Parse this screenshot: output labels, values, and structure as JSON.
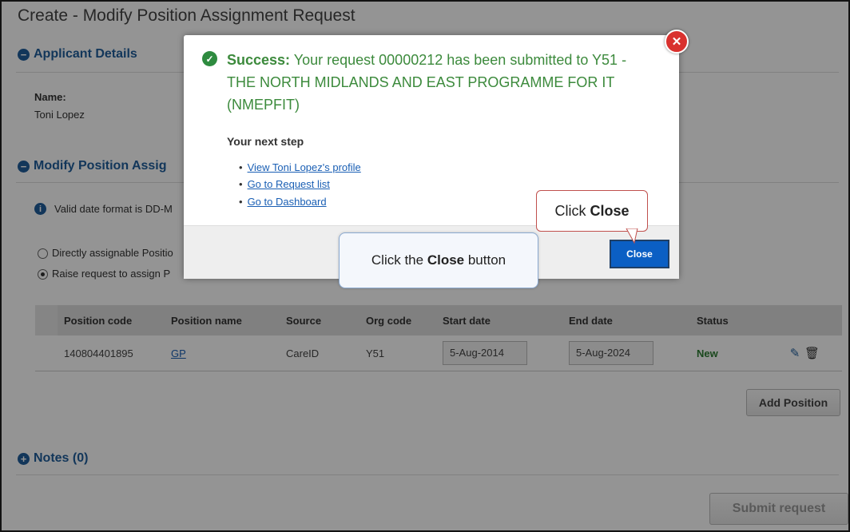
{
  "page": {
    "title": "Create - Modify Position Assignment Request"
  },
  "applicant": {
    "heading": "Applicant Details",
    "name_label": "Name:",
    "name_value": "Toni Lopez"
  },
  "modify": {
    "heading": "Modify Position Assig",
    "info_text": "Valid date format is DD-M",
    "radio_1": "Directly assignable Positio",
    "radio_2": "Raise request to assign P",
    "selected_radio": 2
  },
  "table": {
    "headers": [
      "Position code",
      "Position name",
      "Source",
      "Org code",
      "Start date",
      "End date",
      "Status"
    ],
    "rows": [
      {
        "position_code": "140804401895",
        "position_name": "GP",
        "source": "CareID",
        "org_code": "Y51",
        "start_date": "5-Aug-2014",
        "end_date": "5-Aug-2024",
        "status": "New"
      }
    ]
  },
  "buttons": {
    "add_position": "Add Position",
    "submit_request": "Submit request"
  },
  "notes": {
    "heading": "Notes (0)"
  },
  "modal": {
    "success_prefix": "Success:",
    "success_message": "Your request 00000212 has been submitted to Y51 - THE NORTH MIDLANDS AND EAST PROGRAMME FOR IT (NMEPFIT)",
    "next_step": "Your next step",
    "links": [
      "View Toni Lopez's profile",
      "Go to Request list",
      "Go to Dashboard"
    ],
    "close_button": "Close"
  },
  "callouts": {
    "close_tip_prefix": "Click ",
    "close_tip_bold": "Close",
    "button_tip_prefix": "Click the ",
    "button_tip_bold": "Close",
    "button_tip_suffix": " button"
  },
  "icons": [
    "minus-circle-icon",
    "plus-circle-icon",
    "info-icon",
    "check-circle-icon",
    "close-x-icon",
    "pencil-icon",
    "trash-icon"
  ],
  "colors": {
    "heading_blue": "#1f5e9c",
    "success_green": "#3c8a3c",
    "close_red": "#d9312e",
    "button_blue": "#0b5fc4",
    "status_green": "#2e7d32"
  }
}
